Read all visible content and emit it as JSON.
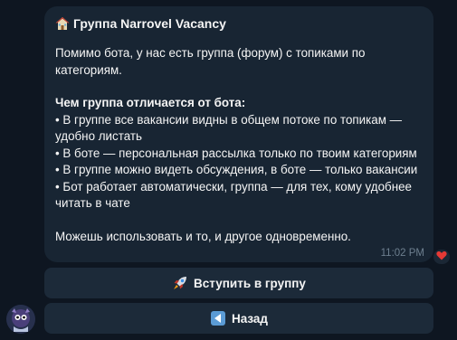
{
  "message": {
    "title": "Группа Narrovel Vacancy",
    "title_icon": "house-icon",
    "intro": "Помимо бота, у нас есть группа (форум) с топиками по категориям.",
    "diff_heading": "Чем группа отличается от бота:",
    "bullets": [
      "• В группе все вакансии видны в общем потоке по топикам — удобно листать",
      "• В боте — персональная рассылка только по твоим категориям",
      "• В группе можно видеть обсуждения, в боте — только вакансии",
      "• Бот работает автоматически, группа — для тех, кому удобнее читать в чате"
    ],
    "outro": "Можешь использовать и то, и другое одновременно.",
    "time": "11:02 PM",
    "reaction": "heart-icon"
  },
  "buttons": {
    "join_label": "Вступить в группу",
    "join_icon": "rocket-icon",
    "back_label": "Назад",
    "back_icon": "left-arrow-icon"
  },
  "colors": {
    "background": "#0e1621",
    "bubble": "#182533",
    "button": "#1c2a39",
    "reaction": "#e53935"
  }
}
